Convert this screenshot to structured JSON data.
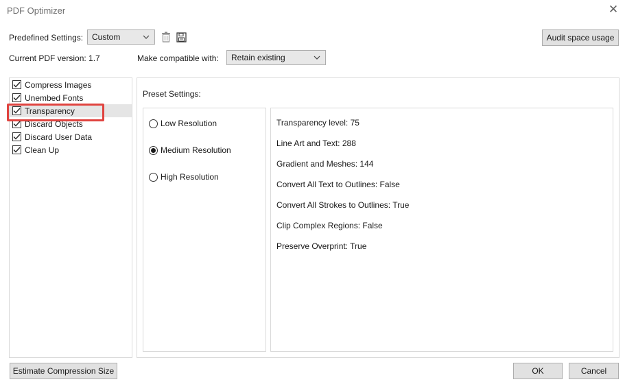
{
  "window": {
    "title": "PDF Optimizer",
    "close_glyph": "✕"
  },
  "top": {
    "predefined_label": "Predefined Settings:",
    "predefined_value": "Custom",
    "audit_button": "Audit space usage",
    "current_version_label": "Current PDF version: 1.7",
    "compatible_label": "Make compatible with:",
    "compatible_value": "Retain existing"
  },
  "categories": [
    {
      "label": "Compress Images",
      "checked": true
    },
    {
      "label": "Unembed Fonts",
      "checked": true
    },
    {
      "label": "Transparency",
      "checked": true,
      "selected": true
    },
    {
      "label": "Discard Objects",
      "checked": true
    },
    {
      "label": "Discard User Data",
      "checked": true
    },
    {
      "label": "Clean Up",
      "checked": true
    }
  ],
  "preset": {
    "heading": "Preset Settings:",
    "options": [
      {
        "label": "Low Resolution",
        "selected": false
      },
      {
        "label": "Medium Resolution",
        "selected": true
      },
      {
        "label": "High Resolution",
        "selected": false
      }
    ],
    "details": [
      "Transparency level: 75",
      "Line Art and Text: 288",
      "Gradient and Meshes: 144",
      "Convert All Text to Outlines: False",
      "Convert All Strokes to Outlines: True",
      "Clip Complex Regions: False",
      "Preserve Overprint: True"
    ]
  },
  "bottom": {
    "estimate_button": "Estimate Compression Size",
    "ok_button": "OK",
    "cancel_button": "Cancel"
  },
  "icons": {
    "trash": "trash-icon",
    "save": "save-icon",
    "chevron": "chevron-down-icon"
  },
  "colors": {
    "highlight": "#e0433f",
    "button_bg": "#e1e1e1",
    "selected_row": "#e5e5e5"
  }
}
